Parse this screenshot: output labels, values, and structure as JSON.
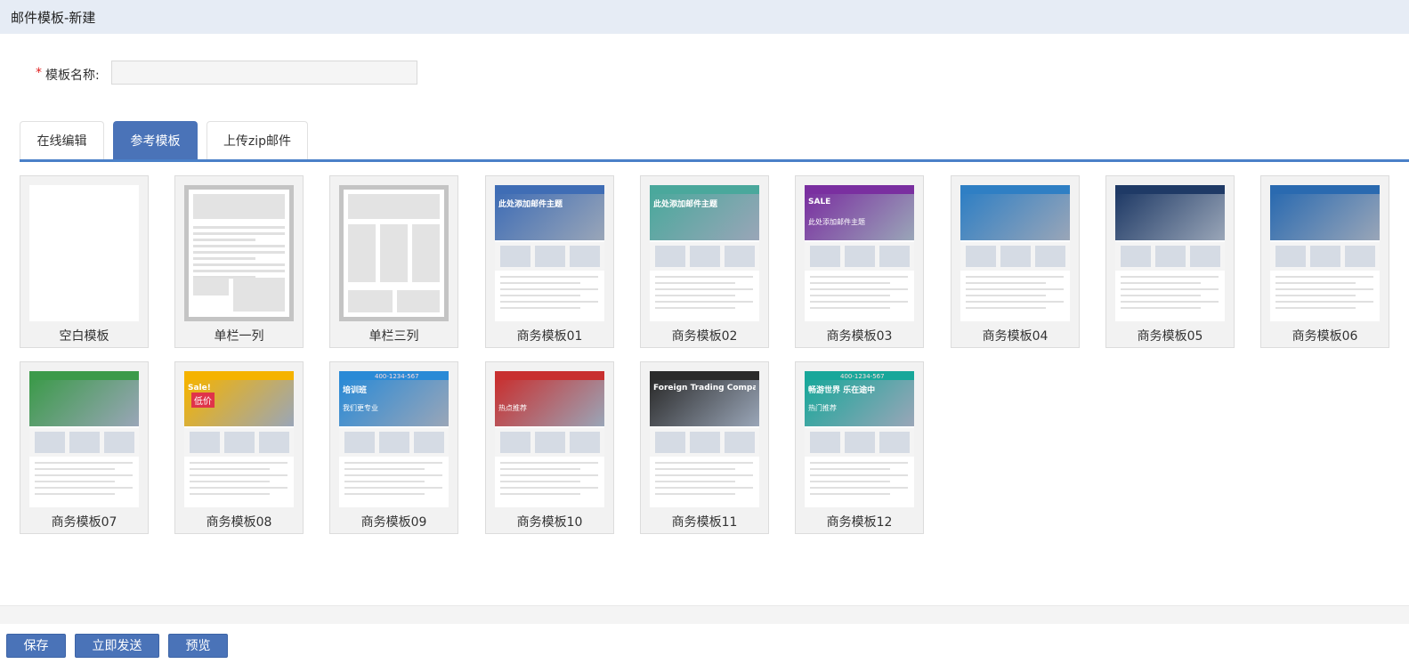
{
  "header": {
    "title": "邮件模板-新建"
  },
  "form": {
    "required_mark": "*",
    "name_label": "模板名称:",
    "name_value": "",
    "name_placeholder": ""
  },
  "tabs": [
    {
      "label": "在线编辑",
      "active": false
    },
    {
      "label": "参考模板",
      "active": true
    },
    {
      "label": "上传zip邮件",
      "active": false
    }
  ],
  "templates": [
    {
      "label": "空白模板",
      "kind": "blank"
    },
    {
      "label": "单栏一列",
      "kind": "single-col"
    },
    {
      "label": "单栏三列",
      "kind": "three-col"
    },
    {
      "label": "商务模板01",
      "kind": "biz",
      "accent": "#3f6db5",
      "headline": "此处添加邮件主题"
    },
    {
      "label": "商务模板02",
      "kind": "biz",
      "accent": "#4aa89c",
      "headline": "此处添加邮件主题"
    },
    {
      "label": "商务模板03",
      "kind": "biz",
      "accent": "#7a2fa0",
      "headline": "SALE",
      "subhead": "此处添加邮件主题"
    },
    {
      "label": "商务模板04",
      "kind": "biz",
      "accent": "#2f7fc4"
    },
    {
      "label": "商务模板05",
      "kind": "biz",
      "accent": "#1f3a66"
    },
    {
      "label": "商务模板06",
      "kind": "biz",
      "accent": "#2a6ab0"
    },
    {
      "label": "商务模板07",
      "kind": "biz",
      "accent": "#3c9a4a"
    },
    {
      "label": "商务模板08",
      "kind": "biz",
      "accent": "#f5b300",
      "headline": "Sale!",
      "badge": "低价"
    },
    {
      "label": "商务模板09",
      "kind": "biz",
      "accent": "#2a8ad6",
      "headline": "培训班",
      "subhead": "我们更专业",
      "phone": "400-1234-567"
    },
    {
      "label": "商务模板10",
      "kind": "biz",
      "accent": "#c83030",
      "subhead": "热点推荐"
    },
    {
      "label": "商务模板11",
      "kind": "biz",
      "accent": "#2b2b2b",
      "headline": "Foreign Trading Company"
    },
    {
      "label": "商务模板12",
      "kind": "biz",
      "accent": "#18a79a",
      "headline": "畅游世界 乐在途中",
      "subhead": "热门推荐",
      "phone": "400-1234-567"
    }
  ],
  "footer": {
    "save_label": "保存",
    "send_label": "立即发送",
    "preview_label": "预览"
  }
}
